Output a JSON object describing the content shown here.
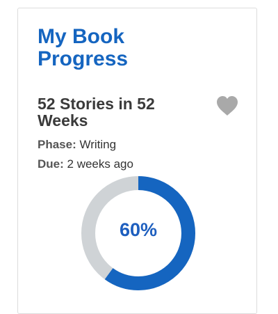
{
  "card": {
    "title": "My Book Progress",
    "book_title": "52 Stories in 52 Weeks",
    "favorite_icon": "heart-icon",
    "phase_label": "Phase:",
    "phase_value": "Writing",
    "due_label": "Due:",
    "due_value": "2 weeks ago",
    "progress_text": "60%",
    "progress_fraction": 0.6
  },
  "colors": {
    "title": "#1565c0",
    "progress_fill": "#1565c0",
    "progress_track": "#cfd3d6",
    "heart": "#a9a9a9"
  }
}
